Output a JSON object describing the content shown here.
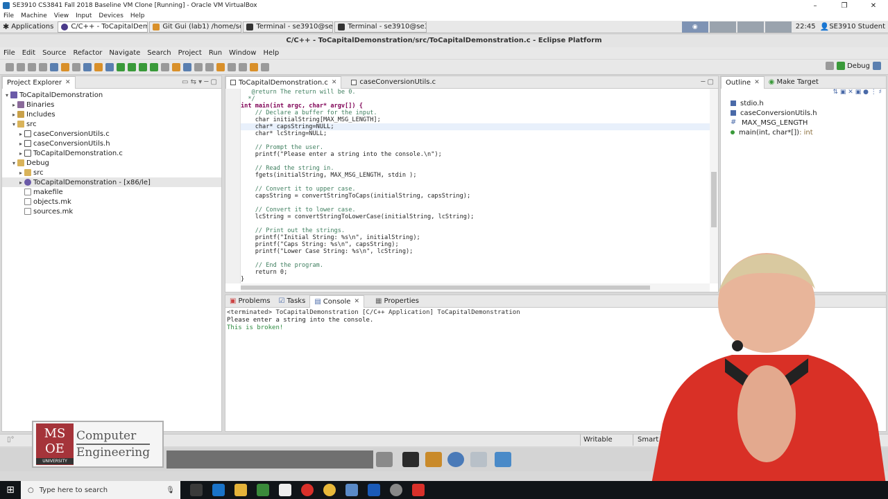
{
  "vbox": {
    "title": "SE3910 CS3841 Fall 2018 Baseline VM Clone [Running] - Oracle VM VirtualBox",
    "menu": [
      "File",
      "Machine",
      "View",
      "Input",
      "Devices",
      "Help"
    ],
    "controls": [
      "–",
      "❐",
      "✕"
    ]
  },
  "panel": {
    "applications": "Applications",
    "tasks": [
      "C/C++ - ToCapitalDemo...",
      "Git Gui (lab1) /home/se3...",
      "Terminal - se3910@se3...",
      "Terminal - se3910@se3..."
    ],
    "clock": "22:45",
    "user": "SE3910 Student"
  },
  "eclipse": {
    "title": "C/C++ - ToCapitalDemonstration/src/ToCapitalDemonstration.c - Eclipse Platform",
    "menu": [
      "File",
      "Edit",
      "Source",
      "Refactor",
      "Navigate",
      "Search",
      "Project",
      "Run",
      "Window",
      "Help"
    ],
    "perspective": "Debug"
  },
  "project_explorer": {
    "tab": "Project Explorer",
    "items": [
      {
        "label": "ToCapitalDemonstration"
      },
      {
        "label": "Binaries"
      },
      {
        "label": "Includes"
      },
      {
        "label": "src"
      },
      {
        "label": "caseConversionUtils.c"
      },
      {
        "label": "caseConversionUtils.h"
      },
      {
        "label": "ToCapitalDemonstration.c"
      },
      {
        "label": "Debug"
      },
      {
        "label": "src"
      },
      {
        "label": "ToCapitalDemonstration - [x86/le]"
      },
      {
        "label": "makefile"
      },
      {
        "label": "objects.mk"
      },
      {
        "label": "sources.mk"
      }
    ]
  },
  "editor": {
    "tabs": [
      "ToCapitalDemonstration.c",
      "caseConversionUtils.c"
    ],
    "lines": [
      "   @return The return will be 0.",
      "  */",
      "int main(int argc, char* argv[]) {",
      "    // Declare a buffer for the input.",
      "    char initialString[MAX_MSG_LENGTH];",
      "    char* capsString=NULL;",
      "    char* lcString=NULL;",
      "",
      "    // Prompt the user.",
      "    printf(\"Please enter a string into the console.\\n\");",
      "",
      "    // Read the string in.",
      "    fgets(initialString, MAX_MSG_LENGTH, stdin );",
      "",
      "    // Convert it to upper case.",
      "    capsString = convertStringToCaps(initialString, capsString);",
      "",
      "    // Convert it to lower case.",
      "    lcString = convertStringToLowerCase(initialString, lcString);",
      "",
      "    // Print out the strings.",
      "    printf(\"Initial String: %s\\n\", initialString);",
      "    printf(\"Caps String: %s\\n\", capsString);",
      "    printf(\"Lower Case String: %s\\n\", lcString);",
      "",
      "    // End the program.",
      "    return 0;",
      "}"
    ]
  },
  "outline": {
    "tabs": [
      "Outline",
      "Make Target"
    ],
    "items": [
      {
        "label": "stdio.h",
        "suffix": ""
      },
      {
        "label": "caseConversionUtils.h",
        "suffix": ""
      },
      {
        "label": "MAX_MSG_LENGTH",
        "suffix": ""
      },
      {
        "label": "main(int, char*[])",
        "suffix": " : int"
      }
    ]
  },
  "console": {
    "tabs": [
      "Problems",
      "Tasks",
      "Console",
      "Properties"
    ],
    "header": "<terminated> ToCapitalDemonstration [C/C++ Application] ToCapitalDemonstration",
    "output": [
      "Please enter a string into the console.",
      "This is broken!"
    ]
  },
  "status": {
    "writable": "Writable",
    "insert_mode": "Smart I"
  },
  "logo": {
    "badge": "MS OE",
    "university": "UNIVERSITY",
    "line1": "Computer",
    "line2": "Engineering"
  },
  "taskbar": {
    "search_placeholder": "Type here to search"
  },
  "colors": {
    "keyword": "#7f0055",
    "comment": "#3f7f5f",
    "string": "#2a00ff",
    "terminated": "#2b8a3e"
  }
}
